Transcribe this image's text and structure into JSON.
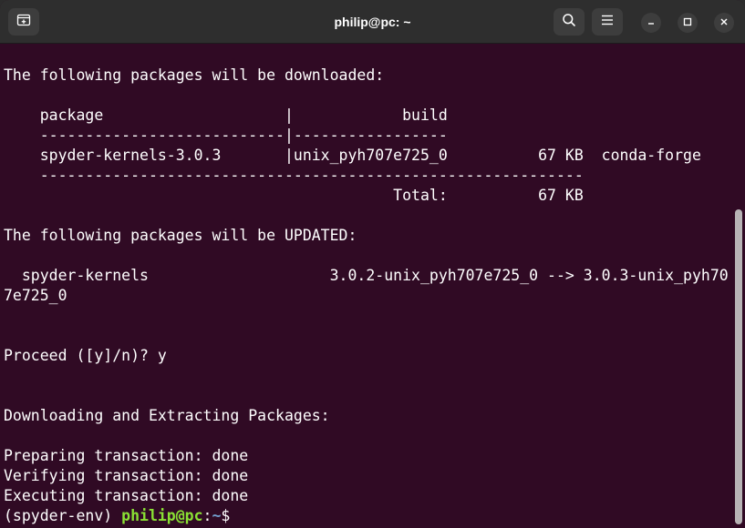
{
  "window": {
    "title": "philip@pc: ~"
  },
  "titlebar_icons": {
    "new_tab": "new-tab-icon",
    "search": "search-icon",
    "menu": "hamburger-menu-icon",
    "minimize": "minimize-icon",
    "maximize": "maximize-icon",
    "close": "close-icon"
  },
  "terminal": {
    "lines": [
      "The following packages will be downloaded:",
      "",
      "    package                    |            build",
      "    ---------------------------|-----------------",
      "    spyder-kernels-3.0.3       |unix_pyh707e725_0          67 KB  conda-forge",
      "    ------------------------------------------------------------",
      "                                           Total:          67 KB",
      "",
      "The following packages will be UPDATED:",
      "",
      "  spyder-kernels                    3.0.2-unix_pyh707e725_0 --> 3.0.3-unix_pyh70",
      "7e725_0",
      "",
      "",
      "Proceed ([y]/n)? y",
      "",
      "",
      "Downloading and Extracting Packages:",
      "",
      "Preparing transaction: done",
      "Verifying transaction: done",
      "Executing transaction: done"
    ],
    "prompt": {
      "env": "(spyder-env) ",
      "user_host": "philip@pc",
      "separator": ":",
      "path": "~",
      "symbol": "$"
    }
  },
  "colors": {
    "background": "#300a24",
    "titlebar": "#2e2e2e",
    "text": "#ffffff",
    "prompt_user": "#8ae234",
    "prompt_path": "#729fcf"
  }
}
